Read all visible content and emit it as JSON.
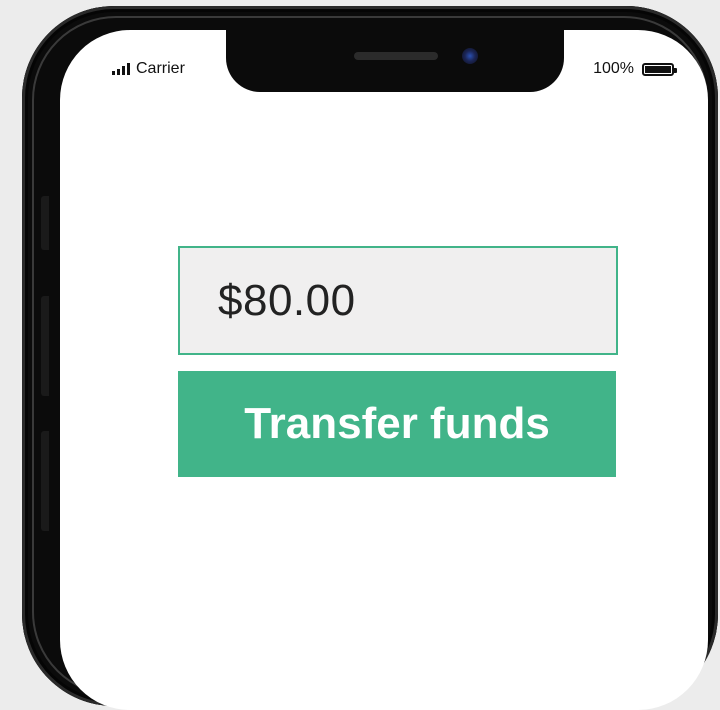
{
  "status_bar": {
    "carrier": "Carrier",
    "battery_percent": "100%",
    "signal_icon": "signal-bars-icon",
    "battery_icon": "battery-full-icon"
  },
  "transfer_form": {
    "amount_value": "$80.00",
    "button_label": "Transfer funds"
  },
  "colors": {
    "accent": "#41b489",
    "field_background": "#f0efef",
    "screen_background": "#ffffff",
    "device_frame": "#0b0b0b",
    "page_background": "#ececec"
  }
}
